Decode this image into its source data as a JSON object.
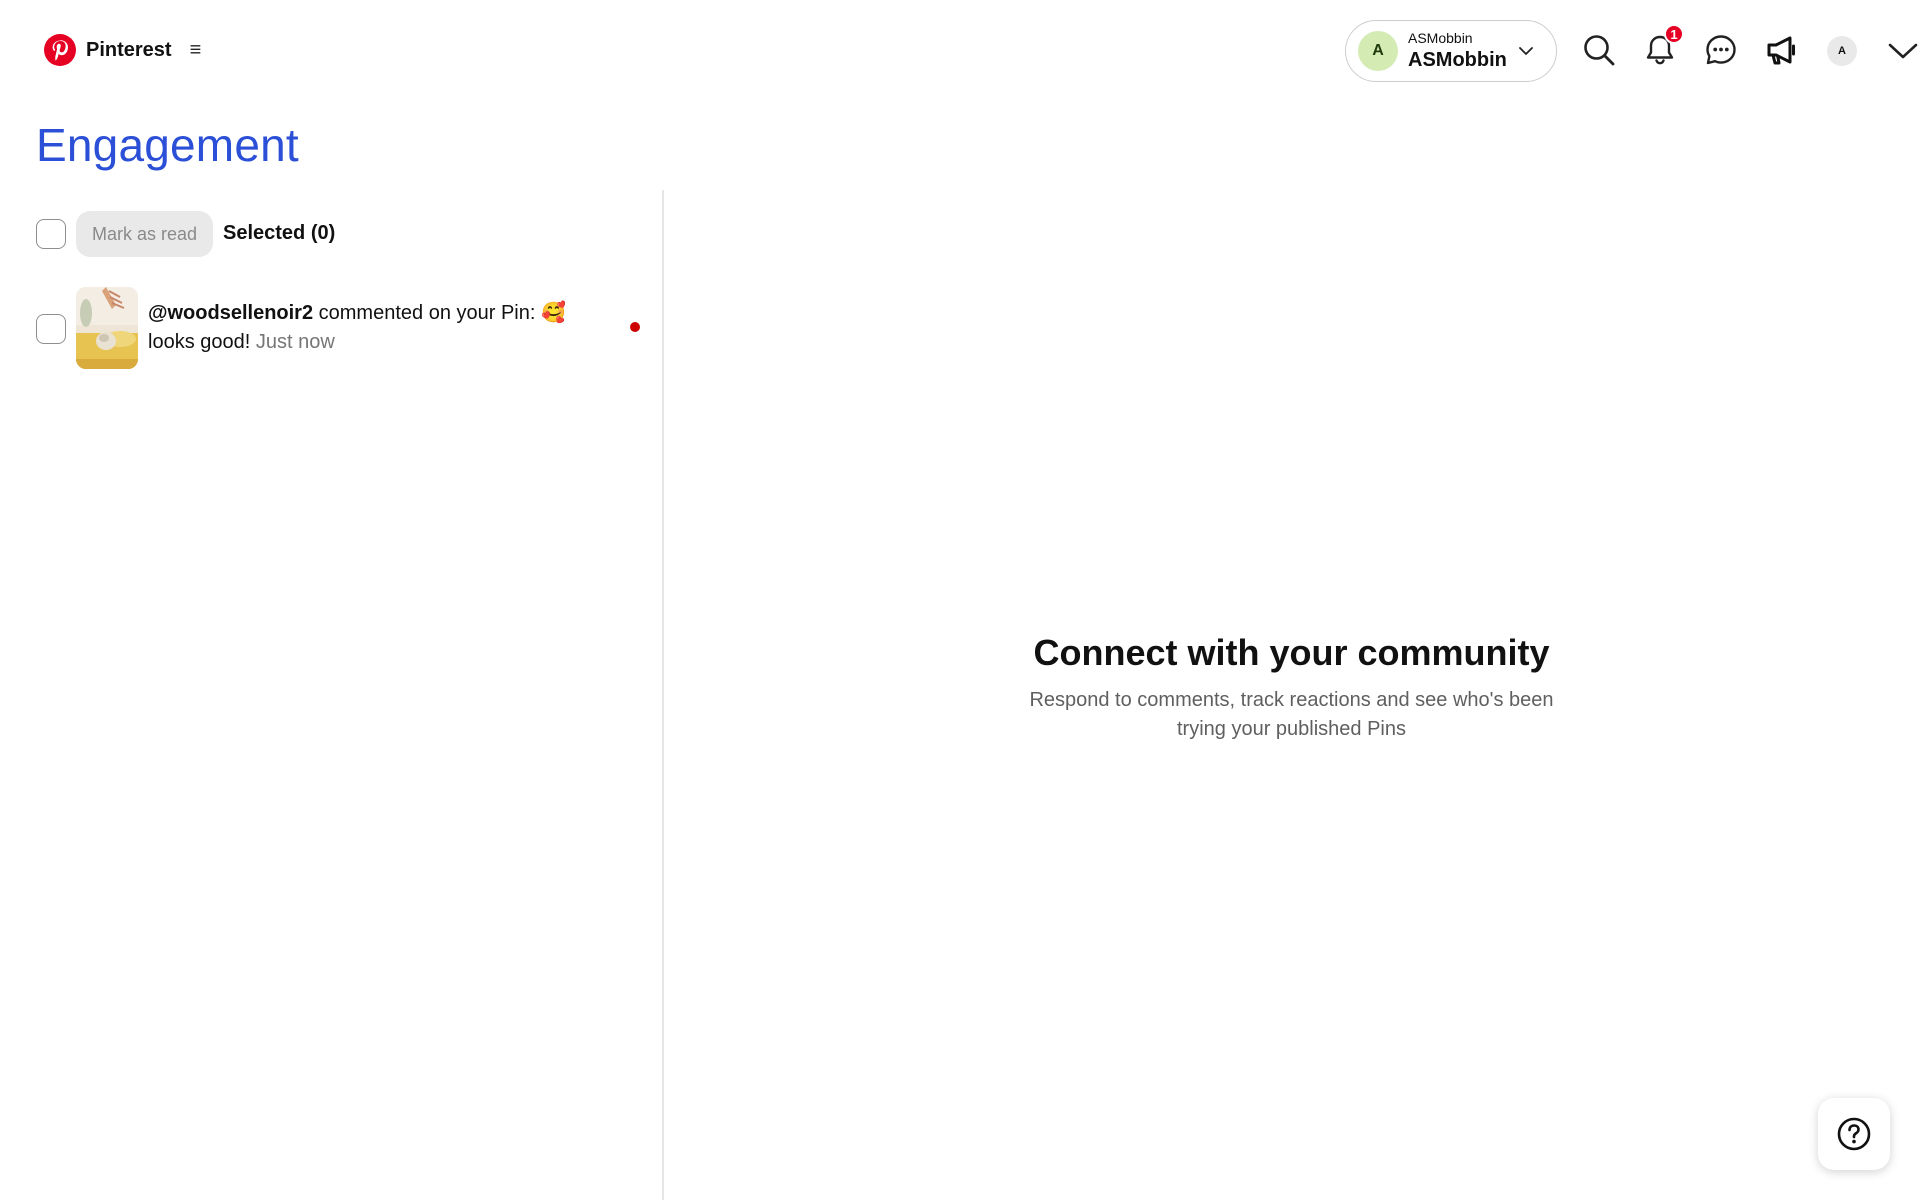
{
  "header": {
    "brand_name": "Pinterest",
    "menu_icon_glyph": "≡",
    "account": {
      "avatar_initial": "A",
      "subtitle": "ASMobbin",
      "name": "ASMobbin"
    },
    "icons": [
      "search-icon",
      "notifications-icon",
      "messages-icon",
      "announcements-icon"
    ],
    "notifications_badge": "1",
    "user_avatar_initial": "A",
    "accent_color": "#e60023"
  },
  "page": {
    "title": "Engagement",
    "title_color": "#2b4fd6"
  },
  "toolbar": {
    "mark_as_read_label": "Mark as read",
    "selected_label": "Selected (0)"
  },
  "notifications": [
    {
      "username": "@woodsellenoir2",
      "action": " commented on your Pin: 🥰 looks good! ",
      "time": "Just now",
      "unread": true
    }
  ],
  "empty_state": {
    "title": "Connect with your community",
    "description_line1": "Respond to comments, track reactions and see who's been",
    "description_line2": "trying your published Pins"
  }
}
